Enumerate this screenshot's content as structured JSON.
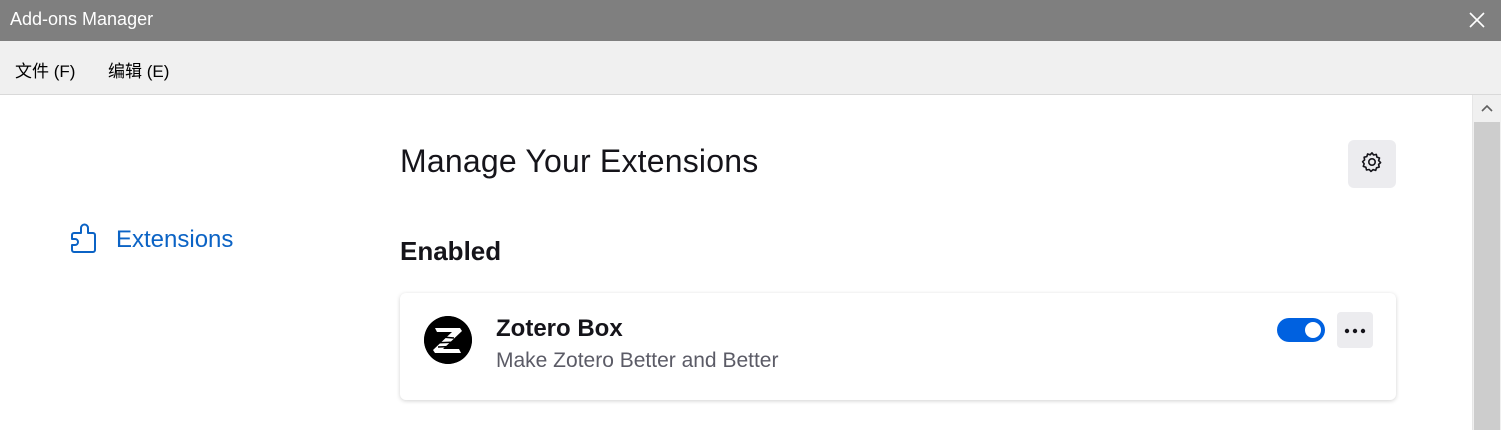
{
  "window": {
    "title": "Add-ons Manager"
  },
  "menubar": {
    "items": [
      {
        "label": "文件 (F)"
      },
      {
        "label": "编辑 (E)"
      }
    ]
  },
  "sidebar": {
    "items": [
      {
        "label": "Extensions",
        "icon": "puzzle-piece-icon",
        "selected": true
      }
    ]
  },
  "main": {
    "heading": "Manage Your Extensions",
    "section_title": "Enabled",
    "extensions": [
      {
        "name": "Zotero Box",
        "description": "Make Zotero Better and Better",
        "enabled": true,
        "icon": "zotero-z-logo-icon"
      }
    ]
  },
  "colors": {
    "accent": "#0b63c5",
    "toggle_on": "#0061e0",
    "titlebar": "#7f7f7f",
    "menubar": "#f0f0f0"
  }
}
